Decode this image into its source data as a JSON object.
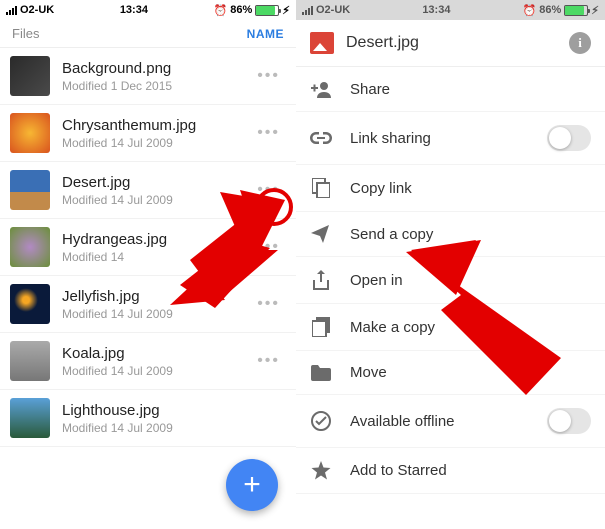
{
  "statusbar": {
    "carrier": "O2-UK",
    "time": "13:34",
    "battery_pct": "86%"
  },
  "list": {
    "header_left": "Files",
    "header_right": "NAME",
    "files": [
      {
        "name": "Background.png",
        "modified": "Modified 1 Dec 2015",
        "thumb": "#2a2a2a"
      },
      {
        "name": "Chrysanthemum.jpg",
        "modified": "Modified 14 Jul 2009",
        "thumb": "#d9531e"
      },
      {
        "name": "Desert.jpg",
        "modified": "Modified 14 Jul 2009",
        "thumb": "#3a6fb5"
      },
      {
        "name": "Hydrangeas.jpg",
        "modified": "Modified 14",
        "thumb": "#6b8f3a"
      },
      {
        "name": "Jellyfish.jpg",
        "modified": "Modified 14 Jul 2009",
        "thumb": "#0a1a3a"
      },
      {
        "name": "Koala.jpg",
        "modified": "Modified 14 Jul 2009",
        "thumb": "#8a8a82"
      },
      {
        "name": "Lighthouse.jpg",
        "modified": "Modified 14 Jul 2009",
        "thumb": "#3a74a8"
      }
    ]
  },
  "sheet": {
    "title": "Desert.jpg",
    "items": [
      {
        "icon": "share",
        "label": "Share"
      },
      {
        "icon": "link",
        "label": "Link sharing",
        "toggle": true
      },
      {
        "icon": "copylink",
        "label": "Copy link"
      },
      {
        "icon": "send",
        "label": "Send a copy"
      },
      {
        "icon": "openin",
        "label": "Open in"
      },
      {
        "icon": "makecopy",
        "label": "Make a copy"
      },
      {
        "icon": "move",
        "label": "Move"
      },
      {
        "icon": "offline",
        "label": "Available offline",
        "toggle": true
      },
      {
        "icon": "star",
        "label": "Add to Starred"
      }
    ]
  }
}
